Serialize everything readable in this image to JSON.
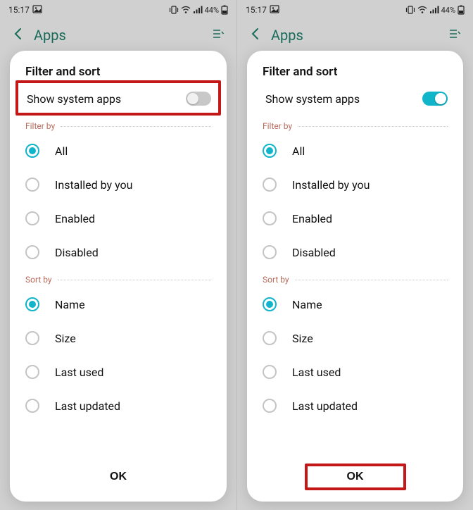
{
  "status": {
    "time": "15:17",
    "battery_text": "44%"
  },
  "header": {
    "title": "Apps"
  },
  "dialog": {
    "title": "Filter and sort",
    "toggle_label": "Show system apps",
    "filter_section": "Filter by",
    "sort_section": "Sort by",
    "filter_options": [
      {
        "label": "All",
        "selected": true
      },
      {
        "label": "Installed by you",
        "selected": false
      },
      {
        "label": "Enabled",
        "selected": false
      },
      {
        "label": "Disabled",
        "selected": false
      }
    ],
    "sort_options": [
      {
        "label": "Name",
        "selected": true
      },
      {
        "label": "Size",
        "selected": false
      },
      {
        "label": "Last used",
        "selected": false
      },
      {
        "label": "Last updated",
        "selected": false
      }
    ],
    "ok_label": "OK"
  },
  "screens": [
    {
      "toggle_on": false,
      "highlight_toggle": true,
      "highlight_ok": false
    },
    {
      "toggle_on": true,
      "highlight_toggle": false,
      "highlight_ok": true
    }
  ]
}
